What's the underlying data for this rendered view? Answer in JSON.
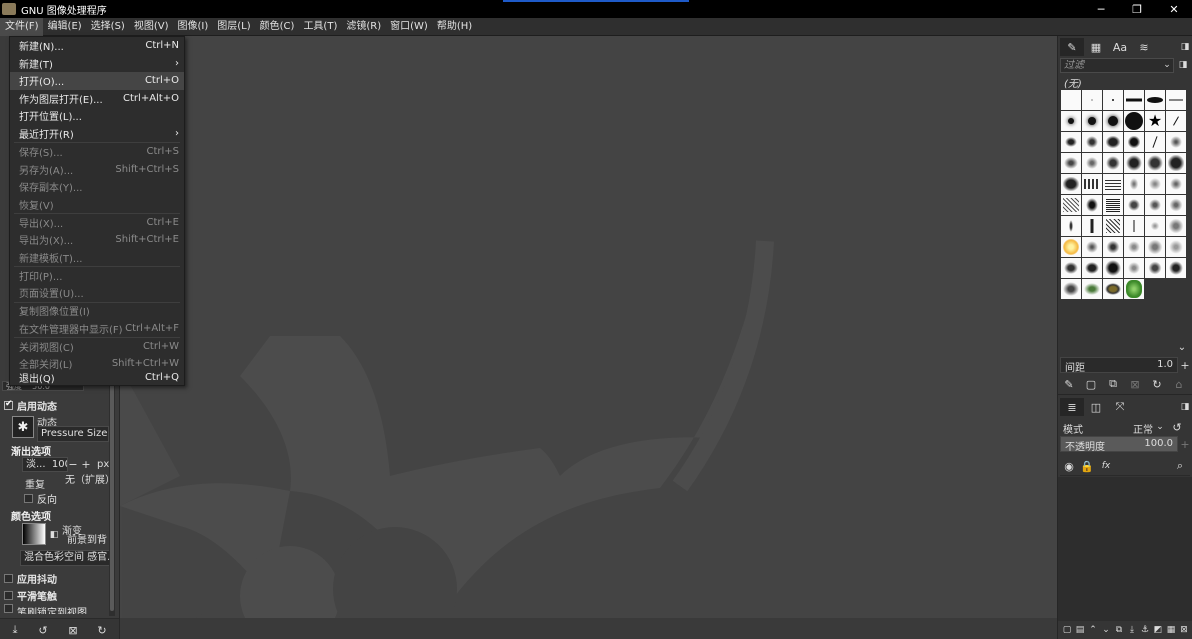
{
  "window": {
    "title": "GNU 图像处理程序",
    "controls": [
      "─",
      "❐",
      "✕"
    ]
  },
  "menubar": [
    "文件(F)",
    "编辑(E)",
    "选择(S)",
    "视图(V)",
    "图像(I)",
    "图层(L)",
    "颜色(C)",
    "工具(T)",
    "滤镜(R)",
    "窗口(W)",
    "帮助(H)"
  ],
  "file_menu": [
    {
      "label": "新建(N)...",
      "shortcut": "Ctrl+N",
      "disabled": false
    },
    {
      "label": "新建(T)",
      "shortcut": "›",
      "disabled": false
    },
    {
      "label": "打开(O)...",
      "shortcut": "Ctrl+O",
      "disabled": false,
      "highlight": true
    },
    {
      "label": "作为图层打开(E)...",
      "shortcut": "Ctrl+Alt+O",
      "disabled": false
    },
    {
      "label": "打开位置(L)...",
      "shortcut": "",
      "disabled": false
    },
    {
      "label": "最近打开(R)",
      "shortcut": "›",
      "disabled": false
    },
    {
      "label": "保存(S)...",
      "shortcut": "Ctrl+S",
      "disabled": true
    },
    {
      "label": "另存为(A)...",
      "shortcut": "Shift+Ctrl+S",
      "disabled": true
    },
    {
      "label": "保存副本(Y)...",
      "shortcut": "",
      "disabled": true
    },
    {
      "label": "恢复(V)",
      "shortcut": "",
      "disabled": true
    },
    {
      "label": "导出(X)...",
      "shortcut": "Ctrl+E",
      "disabled": true
    },
    {
      "label": "导出为(X)...",
      "shortcut": "Shift+Ctrl+E",
      "disabled": true
    },
    {
      "label": "新建模板(T)...",
      "shortcut": "",
      "disabled": true
    },
    {
      "label": "打印(P)...",
      "shortcut": "",
      "disabled": true
    },
    {
      "label": "页面设置(U)...",
      "shortcut": "",
      "disabled": true
    },
    {
      "label": "复制图像位置(I)",
      "shortcut": "",
      "disabled": true
    },
    {
      "label": "在文件管理器中显示(F)",
      "shortcut": "Ctrl+Alt+F",
      "disabled": true
    },
    {
      "label": "关闭视图(C)",
      "shortcut": "Ctrl+W",
      "disabled": true
    },
    {
      "label": "全部关闭(L)",
      "shortcut": "Shift+Ctrl+W",
      "disabled": true
    },
    {
      "label": "退出(Q)",
      "shortcut": "Ctrl+Q",
      "disabled": false
    }
  ],
  "tool_options": {
    "partial_field_label": "强度",
    "partial_field_value": "50.0",
    "enable_dynamics": "启用动态",
    "dynamics_label": "动态",
    "dynamics_value": "Pressure Size",
    "fade_options": "渐出选项",
    "fade_length_label": "淡...",
    "fade_length_value": "100",
    "fade_unit": "px",
    "repeat_label": "重复",
    "repeat_value": "无（扩展）",
    "reverse": "反向",
    "color_options": "颜色选项",
    "gradient_label": "渐变",
    "gradient_value": "前景到背",
    "blend_space": "混合色彩空间 感官...",
    "apply_jitter": "应用抖动",
    "smooth_stroke": "平滑笔触",
    "lock_brush": "笔刷锁定到视图"
  },
  "left_footer_icons": [
    "export-icon",
    "reset-icon",
    "delete-icon",
    "restore-icon"
  ],
  "brushes": {
    "filter_placeholder": "过滤",
    "selected_name": "(无)",
    "spacing_label": "间距",
    "spacing_value": "1.0"
  },
  "layers": {
    "mode_label": "模式",
    "mode_value": "正常",
    "opacity_label": "不透明度",
    "opacity_value": "100.0"
  },
  "colors": {
    "accent": "#1e5ac8",
    "canvas_bg": "#444444",
    "logo_shape": "#4c4c4c"
  }
}
